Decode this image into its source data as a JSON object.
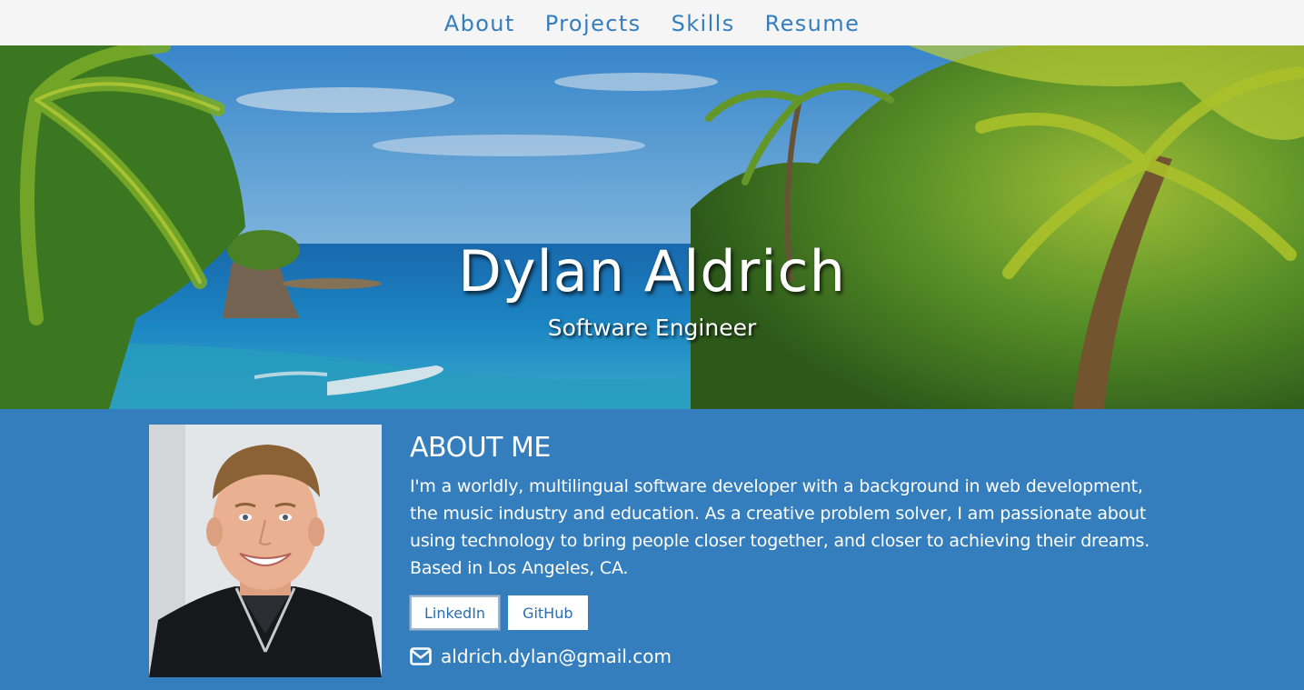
{
  "nav": {
    "items": [
      {
        "label": "About"
      },
      {
        "label": "Projects"
      },
      {
        "label": "Skills"
      },
      {
        "label": "Resume"
      }
    ]
  },
  "hero": {
    "name": "Dylan Aldrich",
    "subtitle": "Software Engineer"
  },
  "about": {
    "heading": "ABOUT ME",
    "bio": "I'm a worldly, multilingual software developer with a background in web development, the music industry and education. As a creative problem solver, I am passionate about using technology to bring people closer together, and closer to achieving their dreams. Based in Los Angeles, CA.",
    "buttons": {
      "linkedin": "LinkedIn",
      "github": "GitHub"
    },
    "email": "aldrich.dylan@gmail.com",
    "email_icon": "envelope-icon"
  },
  "colors": {
    "accent": "#357ebd",
    "nav_bg": "#f5f5f5"
  }
}
